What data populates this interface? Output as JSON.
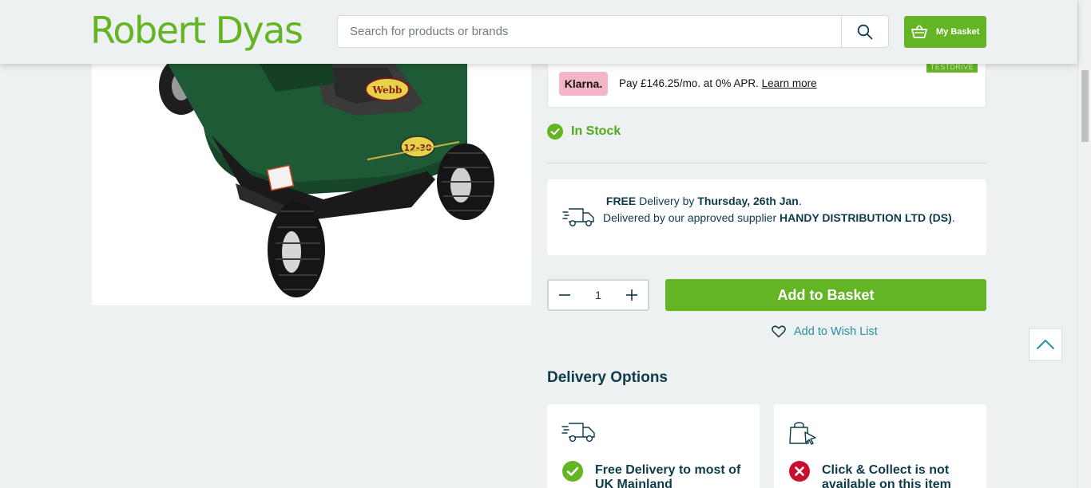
{
  "header": {
    "logo": "Robert Dyas",
    "search_placeholder": "Search for products or brands",
    "basket_label": "My Basket"
  },
  "product_image": {
    "alt": "Webb ride-on lawn mower",
    "badge_text": "12-30",
    "brand_text": "Webb"
  },
  "klarna": {
    "badge": "Klarna.",
    "text": "Pay £146.25/mo. at 0% APR.",
    "link": "Learn more",
    "tag": "TESTDRIVE"
  },
  "stock": {
    "label": "In Stock"
  },
  "delivery": {
    "free": "FREE",
    "by": " Delivery by ",
    "date": "Thursday, 26th Jan",
    "line2_prefix": "Delivered by our approved supplier ",
    "supplier": "HANDY DISTRIBUTION LTD (DS)"
  },
  "purchase": {
    "quantity": "1",
    "add_to_basket": "Add to Basket",
    "wishlist": "Add to Wish List"
  },
  "delivery_options": {
    "heading": "Delivery Options",
    "home": "Free Delivery to most of UK Mainland",
    "collect": "Click & Collect is not available on this item"
  },
  "colors": {
    "brand_green": "#64b524",
    "navy": "#0d3b4a",
    "teal_link": "#2b8da3",
    "error_red": "#c8102e"
  }
}
